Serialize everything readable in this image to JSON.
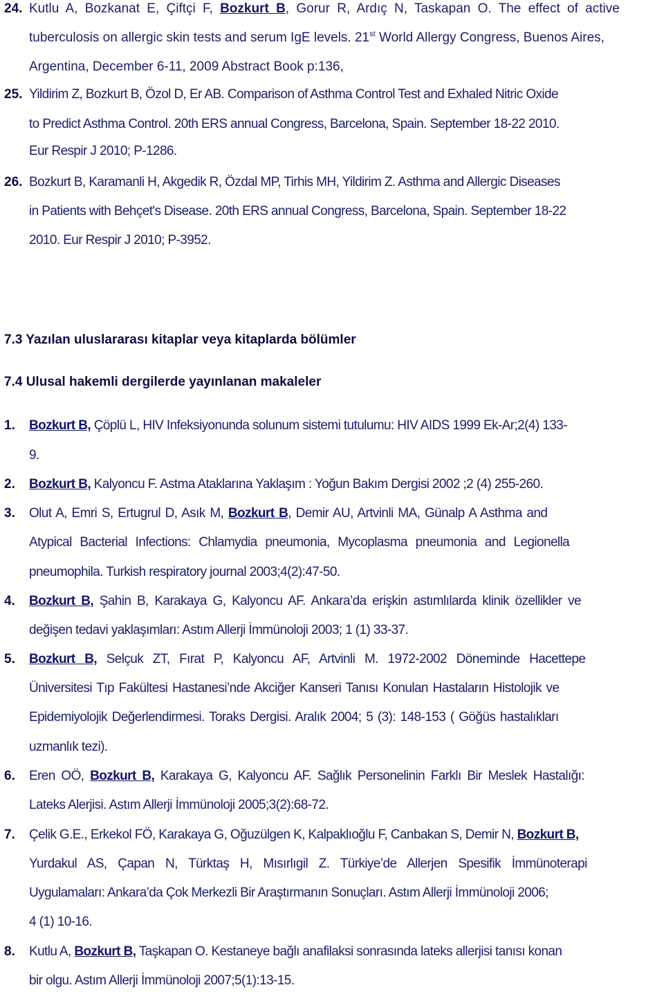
{
  "conference_entries": [
    {
      "number": "24.",
      "lines": [
        {
          "pre": "Kutlu A, Bozkanat E, Çiftçi F, ",
          "me": "Bozkurt B",
          "post": ", Gorur R, Ardıç N, Taskapan O. The effect of active"
        },
        {
          "pre": "tuberculosis on allergic skin tests and serum IgE levels. 21",
          "sup": "st",
          "post": " World Allergy Congress, Buenos Aires,"
        },
        {
          "text": "Argentina, December 6-11, 2009 Abstract Book p:136,"
        }
      ]
    },
    {
      "number": "25.",
      "lines": [
        {
          "text": "Yildirim Z, Bozkurt B, Özol D, Er AB. Comparison of Asthma Control Test and Exhaled Nitric Oxide"
        },
        {
          "text": "to Predict Asthma Control. 20th ERS annual Congress, Barcelona, Spain. September 18-22 2010."
        },
        {
          "text": "Eur Respir J 2010; P-1286."
        }
      ]
    },
    {
      "number": "26.",
      "lines": [
        {
          "text": "Bozkurt B, Karamanli H, Akgedik R, Özdal MP, Tirhis MH, Yildirim Z. Asthma and Allergic Diseases"
        },
        {
          "text": "in Patients with Behçet's Disease. 20th ERS annual Congress, Barcelona, Spain. September 18-22"
        },
        {
          "text": "2010. Eur Respir J 2010; P-3952."
        }
      ]
    }
  ],
  "headings": {
    "h73": "7.3 Yazılan uluslararası kitaplar veya kitaplarda bölümler",
    "h74": "7.4 Ulusal hakemli dergilerde yayınlanan makaleler"
  },
  "national_entries": [
    {
      "number": "1.",
      "lines": [
        {
          "pre": "",
          "me": "Bozkurt B,",
          "post": " Çöplü L, HIV Infeksiyonunda solunum sistemi tutulumu: HIV AIDS 1999 Ek-Ar;2(4) 133-"
        },
        {
          "text": "9."
        }
      ]
    },
    {
      "number": "2.",
      "lines": [
        {
          "pre": "",
          "me": "Bozkurt B,",
          "post": " Kalyoncu F. Astma Ataklarına Yaklaşım : Yoğun Bakım Dergisi 2002 ;2 (4) 255-260."
        }
      ]
    },
    {
      "number": "3.",
      "lines": [
        {
          "pre": "Olut A, Emri S,  Ertugrul D, Asık M,  ",
          "me": "Bozkurt B",
          "post": ", Demir AU, Artvinli MA, Günalp A Asthma and"
        },
        {
          "text": "Atypical Bacterial Infections: Chlamydia pneumonia, Mycoplasma pneumonia and Legionella"
        },
        {
          "text": "pneumophila. Turkish respiratory journal  2003;4(2):47-50."
        }
      ]
    },
    {
      "number": "4.",
      "lines": [
        {
          "pre": "",
          "me": "Bozkurt B,",
          "post": " Şahin B, Karakaya G, Kalyoncu AF. Ankara’da erişkin astımlılarda klinik özellikler ve"
        },
        {
          "text": "değişen tedavi yaklaşımları: Astım Allerji İmmünoloji 2003; 1 (1) 33-37."
        }
      ]
    },
    {
      "number": "5.",
      "lines": [
        {
          "pre": "",
          "me": "Bozkurt B,",
          "post": " Selçuk ZT, Fırat P, Kalyoncu AF, Artvinli M. 1972-2002 Döneminde Hacettepe"
        },
        {
          "text": "Üniversitesi Tıp Fakültesi Hastanesi’nde Akciğer Kanseri Tanısı Konulan Hastaların Histolojik ve"
        },
        {
          "text": "Epidemiyolojik Değerlendirmesi. Toraks Dergisi. Aralık 2004; 5 (3): 148-153 ( Göğüs hastalıkları"
        },
        {
          "text": "uzmanlık tezi)."
        }
      ]
    },
    {
      "number": "6.",
      "lines": [
        {
          "pre": "Eren OÖ, ",
          "me": "Bozkurt B,",
          "post": " Karakaya G, Kalyoncu AF. Sağlık Personelinin Farklı Bir Meslek Hastalığı:"
        },
        {
          "text": "Lateks Alerjisi. Astım Allerji İmmünoloji 2005;3(2):68-72."
        }
      ]
    },
    {
      "number": "7.",
      "lines": [
        {
          "pre": "Çelik G.E., Erkekol FÖ,  Karakaya G, Oğuzülgen K, Kalpaklıoğlu F, Canbakan S,  Demir N, ",
          "me": "Bozkurt B,",
          "post": ""
        },
        {
          "text": "Yurdakul AS, Çapan N, Türktaş H, Mısırlıgil Z. Türkiye’de Allerjen Spesifik İmmünoterapi"
        },
        {
          "text": "Uygulamaları: Ankara’da Çok Merkezli Bir Araştırmanın Sonuçları. Astım Allerji İmmünoloji 2006;"
        },
        {
          "text": "4 (1) 10-16."
        }
      ]
    },
    {
      "number": "8.",
      "lines": [
        {
          "pre": "Kutlu A, ",
          "me": "Bozkurt B,",
          "post": " Taşkapan O. Kestaneye bağlı anafilaksi sonrasında lateks allerjisi tanısı konan"
        },
        {
          "text": "bir olgu. Astım Allerji İmmünoloji 2007;5(1):13-15."
        }
      ]
    }
  ]
}
